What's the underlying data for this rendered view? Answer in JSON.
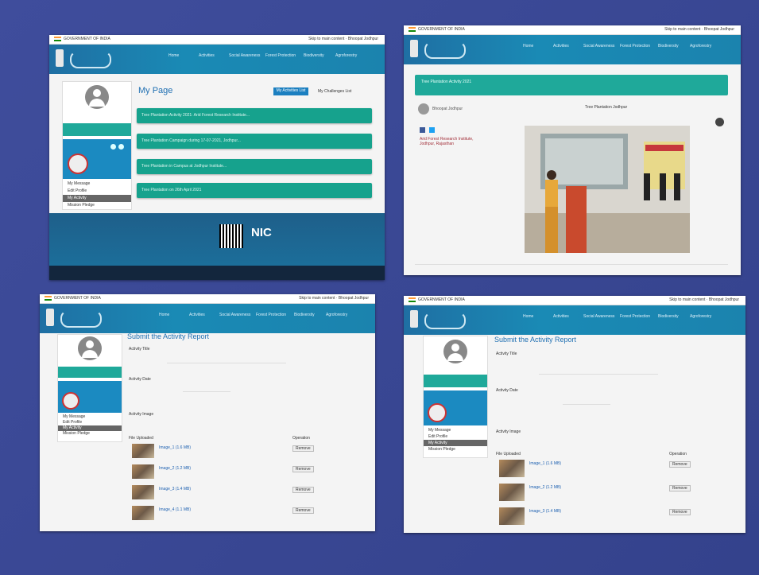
{
  "header": {
    "gov_label": "GOVERNMENT OF INDIA",
    "top_right": "Skip to main content",
    "user": "Bhoopat Jodhpur",
    "nav": [
      "Home",
      "Activities",
      "Social Awareness",
      "Forest Protection",
      "Biodiversity",
      "Agroforestry"
    ]
  },
  "panel1": {
    "title": "My Page",
    "btn_activities": "My Activities List",
    "btn_challenges": "My Challenges List",
    "sidebar": {
      "links": [
        "My Message",
        "Edit Profile",
        "My Activity",
        "Mission Pledge"
      ],
      "selected": 2
    },
    "activities": [
      "Tree Plantation Activity 2021: Arid Forest Research Institute...",
      "Tree Plantation Campaign during 17-07-2021, Jodhpur...",
      "Tree Plantation in Campus at Jodhpur Institute...",
      "Tree Plantation on 26th April 2021"
    ],
    "footer_logo": "NIC"
  },
  "panel2": {
    "event_title": "Tree Plantation Activity 2021",
    "poster_name": "Bhoopat Jodhpur",
    "caption": "Tree Plantation Jodhpur",
    "org": "Arid Forest Research Institute, Jodhpur, Rajasthan"
  },
  "panel3": {
    "title": "Submit the Activity Report",
    "section_title": "Activity Title",
    "section_date": "Activity Date",
    "section_image": "Activity Image",
    "col_file": "File Uploaded",
    "col_op": "Operation",
    "remove": "Remove",
    "sidebar": {
      "links": [
        "My Message",
        "Edit Profile",
        "My Activity",
        "Mission Pledge"
      ],
      "selected": 2
    },
    "files": [
      "Image_1 (1.6 MB)",
      "Image_2 (1.2 MB)",
      "Image_3 (1.4 MB)",
      "Image_4 (1.1 MB)"
    ]
  },
  "panel4": {
    "title": "Submit the Activity Report",
    "section_title": "Activity Title",
    "section_date": "Activity Date",
    "section_image": "Activity Image",
    "col_file": "File Uploaded",
    "col_op": "Operation",
    "remove": "Remove",
    "sidebar": {
      "links": [
        "My Message",
        "Edit Profile",
        "My Activity",
        "Mission Pledge"
      ],
      "selected": 2
    },
    "files": [
      "Image_1 (1.6 MB)",
      "Image_2 (1.2 MB)",
      "Image_3 (1.4 MB)"
    ]
  },
  "colors": {
    "banner": "#1b83ae",
    "teal": "#16a28d",
    "background": "#3b4a95"
  }
}
